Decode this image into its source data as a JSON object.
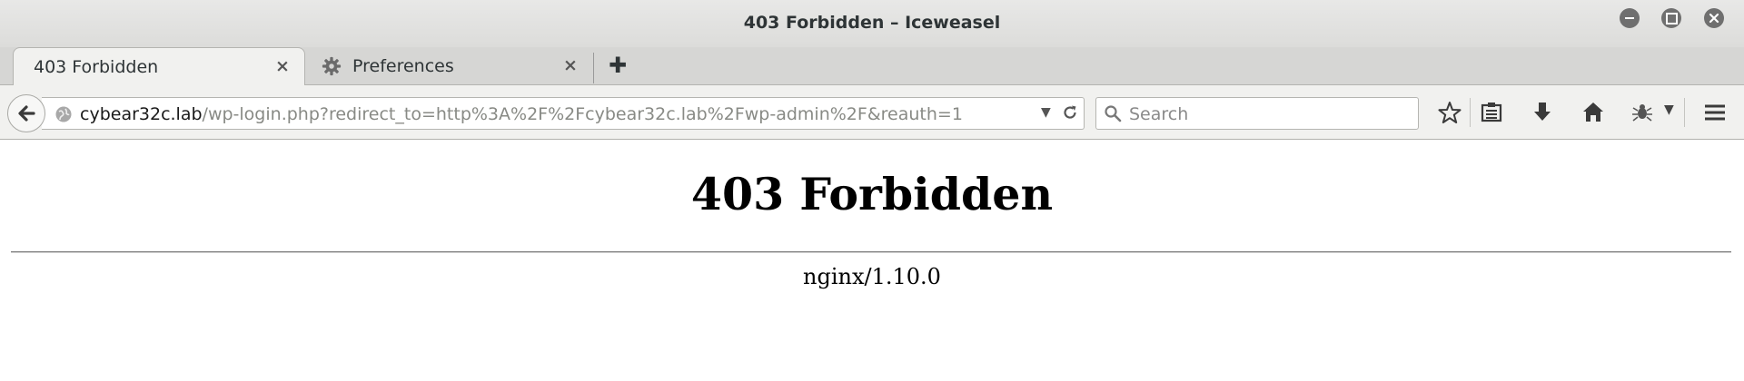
{
  "window": {
    "title": "403 Forbidden – Iceweasel"
  },
  "tabs": [
    {
      "label": "403 Forbidden",
      "active": true
    },
    {
      "label": "Preferences",
      "active": false
    }
  ],
  "tab_close_glyph": "×",
  "new_tab_glyph": "✚",
  "navbar": {
    "url_host": "cybear32c.lab",
    "url_path": "/wp-login.php?redirect_to=http%3A%2F%2Fcybear32c.lab%2Fwp-admin%2F&reauth=1",
    "search_placeholder": "Search",
    "dropdown_glyph": "▼"
  },
  "page": {
    "heading": "403 Forbidden",
    "server_signature": "nginx/1.10.0"
  },
  "icons": {
    "back": "back-arrow-icon",
    "site_identity": "globe-icon",
    "reload": "reload-icon",
    "search": "search-icon",
    "bookmark": "star-icon",
    "reading_list": "bookmarks-menu-icon",
    "downloads": "download-icon",
    "home": "home-icon",
    "extension": "bug-icon",
    "menu": "hamburger-menu-icon"
  },
  "colors": {
    "titlebar": "#dcdcda",
    "toolbar": "#f1f1ef",
    "url_path": "#888a85",
    "wm_button": "#6f6f6f"
  }
}
